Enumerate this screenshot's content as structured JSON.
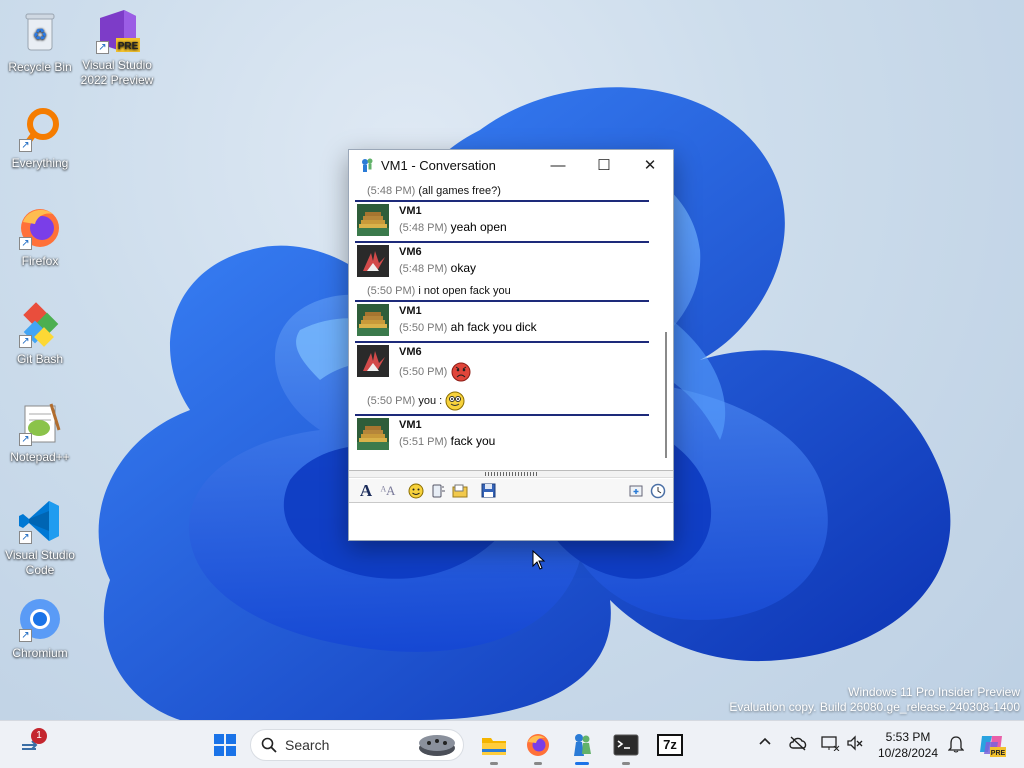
{
  "desktop": {
    "icons": [
      {
        "label": "Recycle Bin",
        "icon": "recycle-bin-icon"
      },
      {
        "label": "Visual Studio 2022 Preview",
        "icon": "visual-studio-preview-icon",
        "badge": "PRE"
      },
      {
        "label": "Everything",
        "icon": "everything-search-icon"
      },
      {
        "label": "Firefox",
        "icon": "firefox-icon"
      },
      {
        "label": "Git Bash",
        "icon": "git-bash-icon"
      },
      {
        "label": "Notepad++",
        "icon": "notepadpp-icon"
      },
      {
        "label": "Visual Studio Code",
        "icon": "vscode-icon"
      },
      {
        "label": "Chromium",
        "icon": "chromium-icon"
      }
    ]
  },
  "window": {
    "title": "VM1 - Conversation",
    "minimize": "—",
    "maximize": "☐",
    "close": "✕",
    "messages": [
      {
        "type": "system",
        "time": "(5:48 PM)",
        "text": "(all games free?)"
      },
      {
        "type": "message",
        "sender": "VM1",
        "time": "(5:48 PM)",
        "text": "yeah open",
        "avatar": "vm1-avatar"
      },
      {
        "type": "message",
        "sender": "VM6",
        "time": "(5:48 PM)",
        "text": "okay",
        "avatar": "vm6-avatar"
      },
      {
        "type": "system",
        "time": "(5:50 PM)",
        "text": "i not open fack you"
      },
      {
        "type": "message",
        "sender": "VM1",
        "time": "(5:50 PM)",
        "text": "ah fack you dick",
        "avatar": "vm1-avatar"
      },
      {
        "type": "message",
        "sender": "VM6",
        "time": "(5:50 PM)",
        "text": "",
        "emoticon": "angry-face-icon",
        "avatar": "vm6-avatar"
      },
      {
        "type": "system",
        "time": "(5:50 PM)",
        "text": "you :",
        "emoticon": "smiley-glasses-icon"
      },
      {
        "type": "message",
        "sender": "VM1",
        "time": "(5:51 PM)",
        "text": "fack you",
        "avatar": "vm1-avatar"
      }
    ],
    "toolbar": [
      "font-icon",
      "font-color-icon",
      "emoticon-icon",
      "nudge-icon",
      "send-file-icon",
      "save-icon",
      "invite-icon",
      "history-icon"
    ],
    "compose_value": ""
  },
  "watermark": {
    "line1": "Windows 11 Pro Insider Preview",
    "line2": "Evaluation copy. Build 26080.ge_release.240308-1400"
  },
  "taskbar": {
    "notification_count": "1",
    "search_label": "Search",
    "time": "5:53 PM",
    "date": "10/28/2024",
    "copilot_badge": "PRE",
    "apps": [
      "file-explorer-icon",
      "firefox-icon",
      "messenger-icon",
      "terminal-icon",
      "7zip-icon"
    ],
    "app_7z_label": "7z"
  },
  "colors": {
    "accent": "#1a73e8",
    "message_divider": "#1d2a7a",
    "wallpaper_blue": "#1f5fe0"
  }
}
